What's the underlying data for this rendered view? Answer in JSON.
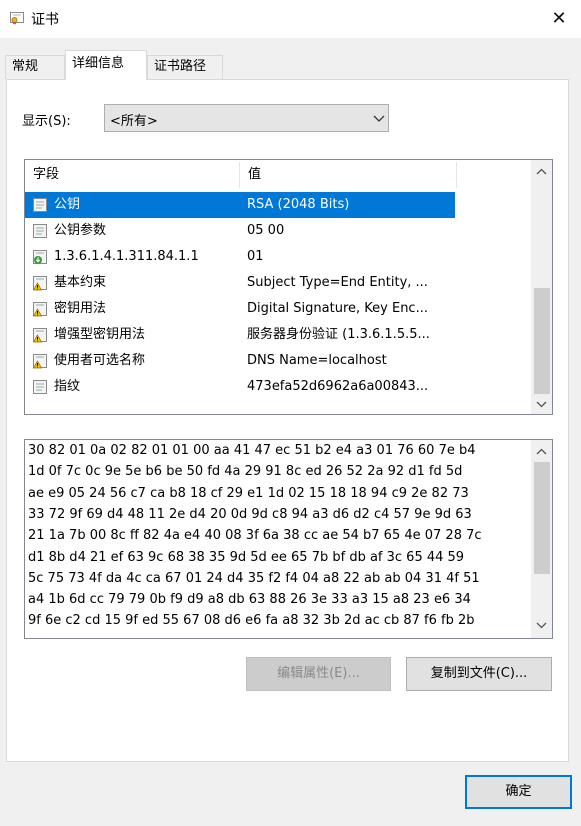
{
  "window": {
    "title": "证书",
    "close_glyph": "✕"
  },
  "tabs": [
    {
      "label": "常规"
    },
    {
      "label": "详细信息"
    },
    {
      "label": "证书路径"
    }
  ],
  "show": {
    "label": "显示(S):",
    "value": "<所有>"
  },
  "list": {
    "columns": [
      "字段",
      "值"
    ],
    "rows": [
      {
        "field": "公钥",
        "value": "RSA (2048 Bits)",
        "icon": "certificate-field-icon",
        "selected": true
      },
      {
        "field": "公钥参数",
        "value": "05 00",
        "icon": "certificate-field-icon"
      },
      {
        "field": "1.3.6.1.4.1.311.84.1.1",
        "value": "01",
        "icon": "extension-download-icon"
      },
      {
        "field": "基本约束",
        "value": "Subject Type=End Entity, ...",
        "icon": "critical-extension-icon"
      },
      {
        "field": "密钥用法",
        "value": "Digital Signature, Key Enc...",
        "icon": "critical-extension-icon"
      },
      {
        "field": "增强型密钥用法",
        "value": "服务器身份验证 (1.3.6.1.5.5...",
        "icon": "critical-extension-icon"
      },
      {
        "field": "使用者可选名称",
        "value": "DNS Name=localhost",
        "icon": "critical-extension-icon"
      },
      {
        "field": "指纹",
        "value": "473efa52d6962a6a00843...",
        "icon": "certificate-field-icon"
      }
    ]
  },
  "hex_lines": [
    "30 82 01 0a 02 82 01 01 00 aa 41 47 ec 51 b2 e4 a3 01 76 60 7e b4",
    "1d 0f 7c 0c 9e 5e b6 be 50 fd 4a 29 91 8c ed 26 52 2a 92 d1 fd 5d",
    "ae e9 05 24 56 c7 ca b8 18 cf 29 e1 1d 02 15 18 18 94 c9 2e 82 73",
    "33 72 9f 69 d4 48 11 2e d4 20 0d 9d c8 94 a3 d6 d2 c4 57 9e 9d 63",
    "21 1a 7b 00 8c ff 82 4a e4 40 08 3f 6a 38 cc ae 54 b7 65 4e 07 28 7c",
    "d1 8b d4 21 ef 63 9c 68 38 35 9d 5d ee 65 7b bf db af 3c 65 44 59",
    "5c 75 73 4f da 4c ca 67 01 24 d4 35 f2 f4 04 a8 22 ab ab 04 31 4f 51",
    "a4 1b 6d cc 79 79 0b f9 d9 a8 db 63 88 26 3e 33 a3 15 a8 23 e6 34",
    "9f 6e c2 cd 15 9f ed 55 67 08 d6 e6 fa a8 32 3b 2d ac cb 87 f6 fb 2b"
  ],
  "buttons": {
    "edit_properties": "编辑属性(E)...",
    "copy_to_file": "复制到文件(C)...",
    "ok": "确定"
  },
  "colors": {
    "selection": "#0078d7",
    "accent": "#0078d7"
  }
}
